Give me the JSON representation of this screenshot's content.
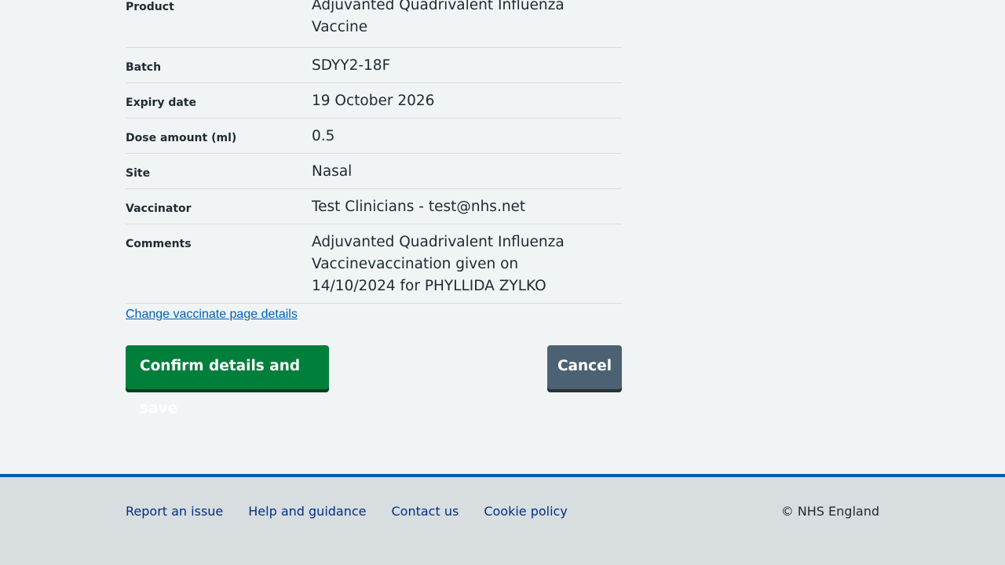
{
  "summary": {
    "rows": [
      {
        "key": "Product",
        "value": "Adjuvanted Quadrivalent Influenza Vaccine"
      },
      {
        "key": "Batch",
        "value": "SDYY2-18F"
      },
      {
        "key": "Expiry date",
        "value": "19 October 2026"
      },
      {
        "key": "Dose amount (ml)",
        "value": "0.5"
      },
      {
        "key": "Site",
        "value": "Nasal"
      },
      {
        "key": "Vaccinator",
        "value": "Test Clinicians - test@nhs.net"
      },
      {
        "key": "Comments",
        "value": "Adjuvanted Quadrivalent Influenza Vaccinevaccination given on 14/10/2024 for PHYLLIDA ZYLKO"
      }
    ]
  },
  "change_link": "Change vaccinate page details",
  "actions": {
    "confirm_label": "Confirm details and save",
    "cancel_label": "Cancel"
  },
  "footer": {
    "links": [
      "Report an issue",
      "Help and guidance",
      "Contact us",
      "Cookie policy"
    ],
    "copyright": "© NHS England"
  },
  "colors": {
    "primary_button": "#007f3b",
    "secondary_button": "#4c6272",
    "link": "#005eb8",
    "footer_border": "#005eb8"
  }
}
